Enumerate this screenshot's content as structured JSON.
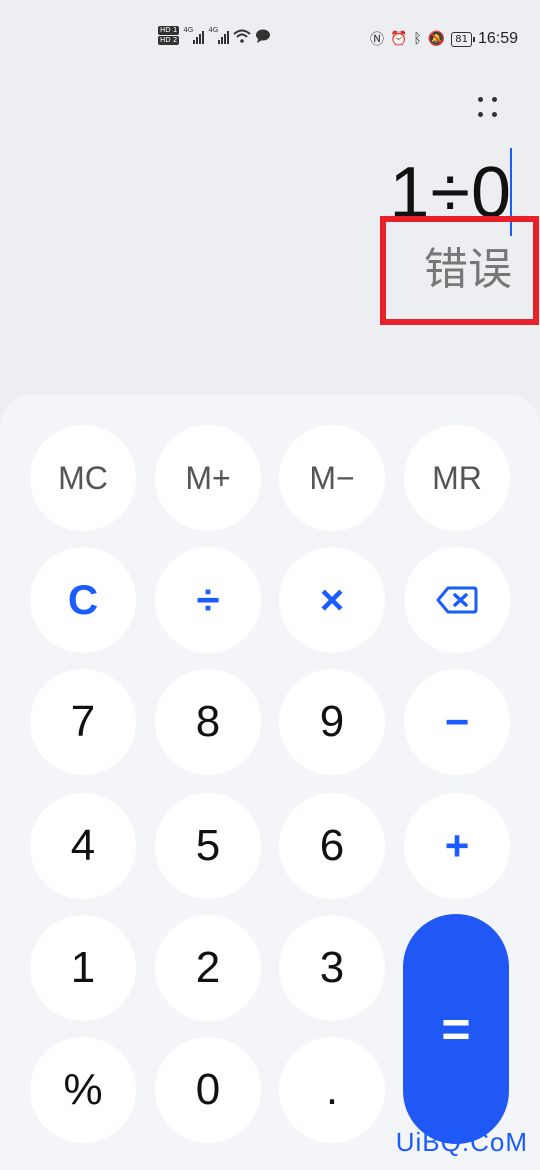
{
  "status_bar": {
    "hd1": "HD 1",
    "hd2": "HD 2",
    "net1": "4G",
    "net2": "4G",
    "battery": "81",
    "time": "16:59",
    "icons": [
      "nfc-icon",
      "alarm-icon",
      "bluetooth-icon",
      "mute-icon"
    ]
  },
  "display": {
    "expression": "1÷0",
    "result": "错误"
  },
  "keys": {
    "mc": "MC",
    "m_plus": "M+",
    "m_minus": "M−",
    "mr": "MR",
    "clear": "C",
    "divide": "÷",
    "multiply": "×",
    "k7": "7",
    "k8": "8",
    "k9": "9",
    "minus": "−",
    "k4": "4",
    "k5": "5",
    "k6": "6",
    "plus": "+",
    "k1": "1",
    "k2": "2",
    "k3": "3",
    "equals": "=",
    "percent": "%",
    "k0": "0",
    "dot": "."
  },
  "colors": {
    "accent": "#1a5cff",
    "equals_bg": "#2058f5",
    "highlight_box": "#e8202a"
  },
  "watermark": "UiBQ.CoM"
}
